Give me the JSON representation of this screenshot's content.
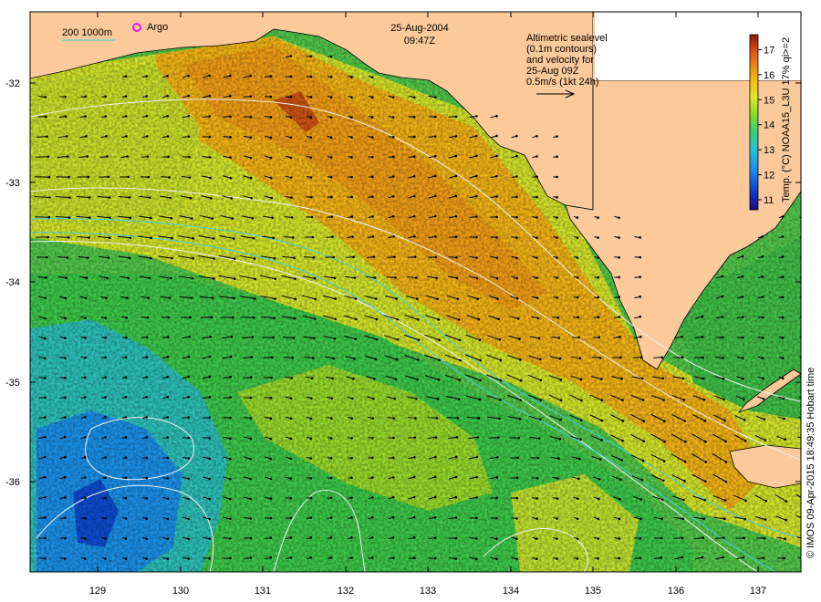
{
  "header": {
    "date": "25-Aug-2004",
    "time": "09:47Z"
  },
  "legend": {
    "isobath_label": "200  1000m",
    "argo_label": "Argo",
    "isobath_color": "#40d0e0",
    "argo_color": "#e020e0"
  },
  "annotation": {
    "lines": [
      "Altimetric sealevel",
      "(0.1m contours)",
      "and velocity for",
      "25-Aug 09Z",
      "0.5m/s (1kt 24h)"
    ]
  },
  "colorbar": {
    "title": "Temp. (°C) NOAA15_L3U 17% qi>=2",
    "ticks": [
      "11",
      "12",
      "13",
      "14",
      "15",
      "16",
      "17"
    ],
    "min": 10.6,
    "max": 17.6,
    "colors": [
      "#1a0a80",
      "#0b38c8",
      "#1b8af0",
      "#2ac0d8",
      "#38d070",
      "#8ade20",
      "#dfe82a",
      "#f5c010",
      "#f08a10",
      "#d85010",
      "#8a1808"
    ]
  },
  "axes": {
    "x_ticks": [
      "129",
      "130",
      "131",
      "132",
      "133",
      "134",
      "135",
      "136",
      "137"
    ],
    "y_ticks": [
      "-32",
      "-33",
      "-34",
      "-35",
      "-36"
    ],
    "lon_range": [
      128.22,
      137.55
    ],
    "lat_range": [
      -36.92,
      -31.54
    ]
  },
  "footer": {
    "credit": "© IMOS 09-Apr-2015 18:49:35 Hobart time"
  },
  "colors": {
    "land": "#fbc99a",
    "contour": "#f0f0f0",
    "isobath": "#40d0e0",
    "arrow": "#000000"
  }
}
